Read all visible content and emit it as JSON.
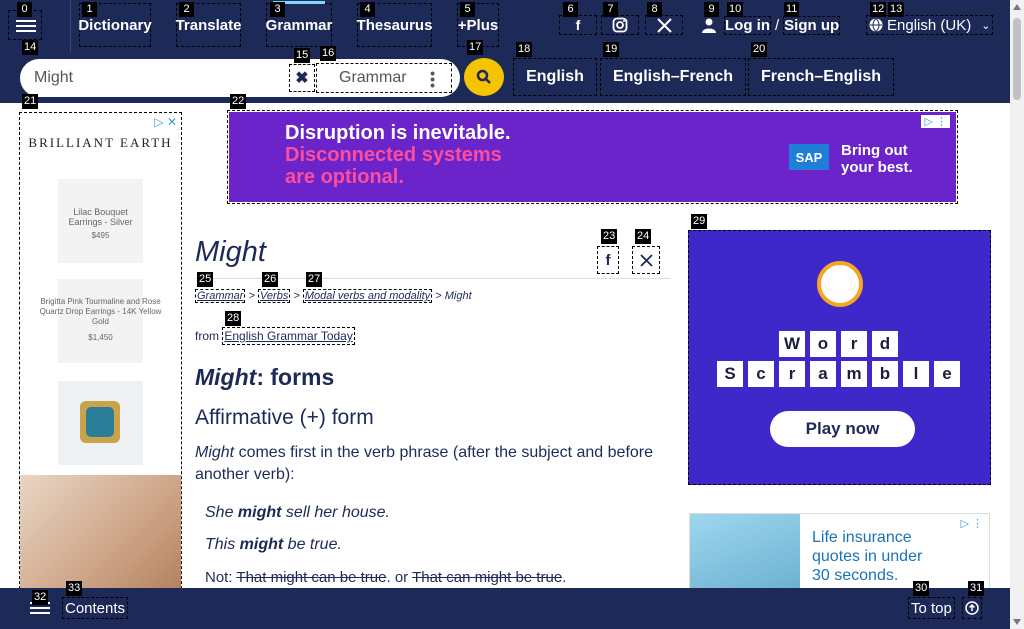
{
  "nav": {
    "items": [
      "Dictionary",
      "Translate",
      "Grammar",
      "Thesaurus",
      "+Plus"
    ],
    "login": "Log in",
    "sep": "/",
    "signup": "Sign up",
    "language": "English (UK)"
  },
  "search": {
    "value": "Might",
    "dictionary": "Grammar",
    "quick_links": [
      "English",
      "English–French",
      "French–English"
    ]
  },
  "left_ad": {
    "brand": "BRILLIANT EARTH",
    "products": [
      {
        "name": "Lilac Bouquet Earrings - Silver",
        "price": "$495"
      },
      {
        "name": "Brigitta Pink Tourmaline and Rose Quartz Drop Earrings - 14K Yellow Gold",
        "price": "$1,450"
      }
    ]
  },
  "banner_ad": {
    "line1": "Disruption is inevitable.",
    "line2": "Disconnected systems",
    "line3": "are optional.",
    "logo": "SAP",
    "tagline1": "Bring out",
    "tagline2": "your best."
  },
  "page": {
    "title": "Might",
    "breadcrumbs": [
      "Grammar",
      "Verbs",
      "Modal verbs and modality",
      "Might"
    ],
    "from_label": "from",
    "source": "English Grammar Today",
    "h2_word": "Might",
    "h2_rest": ": forms",
    "h3": "Affirmative (+) form",
    "para_word": "Might",
    "para_rest": " comes first in the verb phrase (after the subject and before another verb):",
    "ex1_a": "She ",
    "ex1_b": "might",
    "ex1_c": " sell her house.",
    "ex2_a": "This ",
    "ex2_b": "might",
    "ex2_c": " be true.",
    "not_label": "Not: ",
    "not_1": "That might can be true",
    "not_or": ". or ",
    "not_2": "That can might be true",
    "not_end": "."
  },
  "right_ad": {
    "word1": [
      "W",
      "o",
      "r",
      "d"
    ],
    "word2": [
      "S",
      "c",
      "r",
      "a",
      "m",
      "b",
      "l",
      "e"
    ],
    "button": "Play now"
  },
  "right_ad2": {
    "line1": "Life insurance",
    "line2": "quotes in under",
    "line3": "30 seconds."
  },
  "bottom": {
    "contents": "Contents",
    "to_top": "To top"
  },
  "markers": [
    "0",
    "1",
    "2",
    "3",
    "4",
    "5",
    "6",
    "7",
    "8",
    "9",
    "10",
    "11",
    "12",
    "13",
    "14",
    "15",
    "16",
    "17",
    "18",
    "19",
    "20",
    "21",
    "22",
    "23",
    "24",
    "25",
    "26",
    "27",
    "28",
    "29",
    "30",
    "31",
    "32",
    "33"
  ]
}
